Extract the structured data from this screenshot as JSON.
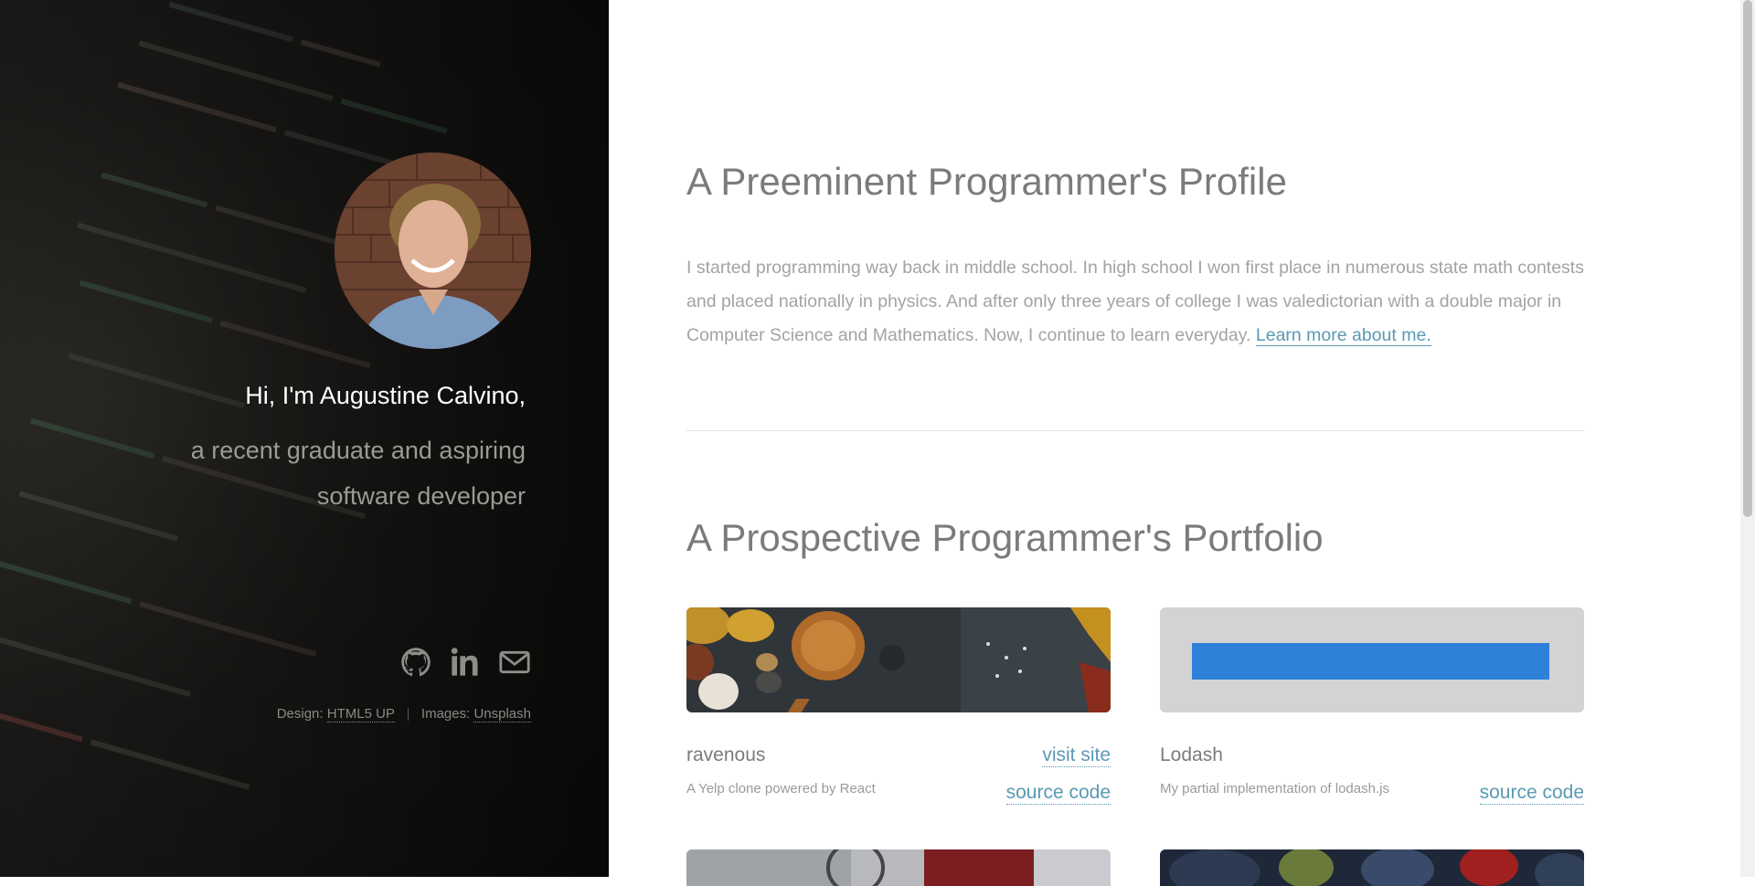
{
  "sidebar": {
    "greeting_line1": "Hi, I'm Augustine Calvino,",
    "greeting_line2": "a recent graduate and aspiring software developer",
    "social": [
      {
        "name": "github-icon"
      },
      {
        "name": "linkedin-icon"
      },
      {
        "name": "envelope-icon"
      }
    ],
    "credits": {
      "design_label": "Design:",
      "design_link": "HTML5 UP",
      "images_label": "Images:",
      "images_link": "Unsplash"
    }
  },
  "about": {
    "title": "A Preeminent Programmer's Profile",
    "text": "I started programming way back in middle school. In high school I won first place in numerous state math contests and placed nationally in physics. And after only three years of college I was valedictorian with a double major in Computer Science and Mathematics. Now, I continue to learn everyday.",
    "link": "Learn more about me."
  },
  "portfolio": {
    "title": "A Prospective Programmer's Portfolio",
    "projects": [
      {
        "title": "ravenous",
        "description": "A Yelp clone powered by React",
        "visit_label": "visit site",
        "source_label": "source code"
      },
      {
        "title": "Lodash",
        "description": "My partial implementation of lodash.js",
        "source_label": "source code"
      }
    ]
  },
  "colors": {
    "link": "#5a9ab3",
    "heading": "#7b7b7b",
    "body_text": "#a3a3a3",
    "lodash_bar": "#2e80d8"
  }
}
